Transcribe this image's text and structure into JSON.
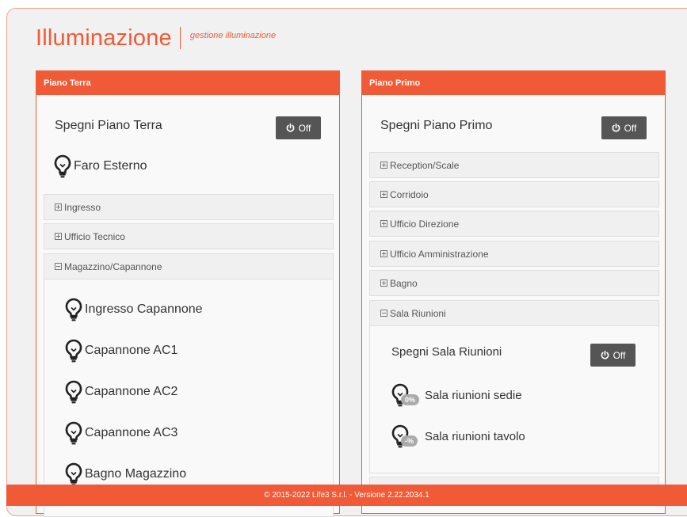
{
  "header": {
    "title": "Illuminazione",
    "subtitle": "gestione illuminazione"
  },
  "left_panel": {
    "title": "Piano Terra",
    "master": {
      "label": "Spegni Piano Terra",
      "button": "Off"
    },
    "single_light": "Faro Esterno",
    "sections": [
      {
        "label": "Ingresso",
        "expanded": false
      },
      {
        "label": "Ufficio Tecnico",
        "expanded": false
      },
      {
        "label": "Magazzino/Capannone",
        "expanded": true
      }
    ],
    "magazzino_lights": [
      "Ingresso Capannone",
      "Capannone AC1",
      "Capannone AC2",
      "Capannone AC3",
      "Bagno Magazzino"
    ]
  },
  "right_panel": {
    "title": "Piano Primo",
    "master": {
      "label": "Spegni Piano Primo",
      "button": "Off"
    },
    "sections": [
      {
        "label": "Reception/Scale",
        "expanded": false
      },
      {
        "label": "Corridoio",
        "expanded": false
      },
      {
        "label": "Ufficio Direzione",
        "expanded": false
      },
      {
        "label": "Ufficio Amministrazione",
        "expanded": false
      },
      {
        "label": "Bagno",
        "expanded": false
      },
      {
        "label": "Sala Riunioni",
        "expanded": true
      }
    ],
    "sala": {
      "master_label": "Spegni Sala Riunioni",
      "button": "Off",
      "lights": [
        {
          "label": "Sala riunioni sedie",
          "level": "0%"
        },
        {
          "label": "Sala riunioni tavolo",
          "level": "-%"
        }
      ]
    }
  },
  "footer": {
    "text": "© 2015-2022 Life3 S.r.l. - Versione 2.22.2034.1"
  },
  "colors": {
    "accent": "#f05a36",
    "button": "#555555"
  }
}
